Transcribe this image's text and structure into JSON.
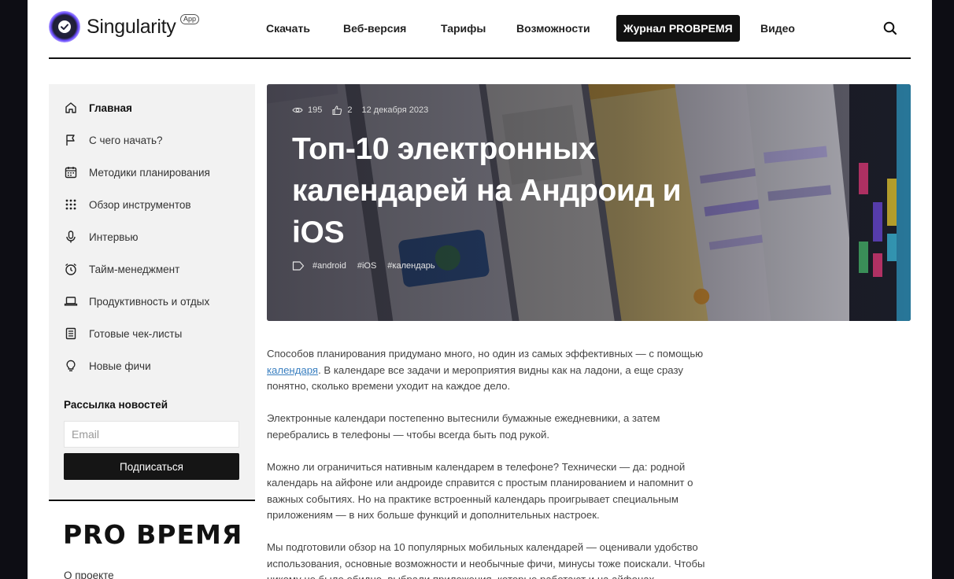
{
  "header": {
    "logo_text": "Singularity",
    "logo_badge": "App",
    "nav": [
      {
        "label": "Скачать"
      },
      {
        "label": "Веб-версия"
      },
      {
        "label": "Тарифы"
      },
      {
        "label": "Возможности"
      },
      {
        "label": "Журнал PROВРЕМЯ"
      },
      {
        "label": "Видео"
      }
    ],
    "search_icon": "search-icon"
  },
  "sidebar": {
    "items": [
      {
        "label": "Главная",
        "icon": "home-icon"
      },
      {
        "label": "С чего начать?",
        "icon": "flag-icon"
      },
      {
        "label": "Методики планирования",
        "icon": "calendar-icon"
      },
      {
        "label": "Обзор инструментов",
        "icon": "grid-dots-icon"
      },
      {
        "label": "Интервью",
        "icon": "microphone-icon"
      },
      {
        "label": "Тайм-менеджмент",
        "icon": "alarm-clock-icon"
      },
      {
        "label": "Продуктивность и отдых",
        "icon": "laptop-icon"
      },
      {
        "label": "Готовые чек-листы",
        "icon": "checklist-icon"
      },
      {
        "label": "Новые фичи",
        "icon": "lightbulb-icon"
      }
    ],
    "newsletter_title": "Рассылка новостей",
    "email_placeholder": "Email",
    "subscribe_label": "Подписаться",
    "brand": "PRO ВРЕМЯ",
    "about_link": "О проекте"
  },
  "hero": {
    "views": "195",
    "likes": "2",
    "date": "12 декабря 2023",
    "title": "Топ-10 электронных календарей на Андроид и iOS",
    "tags": [
      "#android",
      "#iOS",
      "#календарь"
    ]
  },
  "article": {
    "p1_before": "Способов планирования придумано много, но один из самых эффективных — с помощью ",
    "p1_link": "календаря",
    "p1_after": ". В календаре все задачи и мероприятия видны как на ладони, а еще сразу понятно, сколько времени уходит на каждое дело.",
    "p2": "Электронные календари постепенно вытеснили бумажные ежедневники, а затем перебрались в телефоны — чтобы всегда быть под рукой.",
    "p3": "Можно ли ограничиться нативным календарем в телефоне? Технически — да: родной календарь на айфоне или андроиде справится с простым планированием и напомнит о важных событиях. Но на практике встроенный календарь проигрывает специальным приложениям — в них больше функций и дополнительных настроек.",
    "p4": "Мы подготовили обзор на 10 популярных мобильных календарей — оценивали удобство использования, основные возможности и необычные фичи, минусы тоже поискали. Чтобы никому не было обидно, выбрали приложения, которые работают и на айфонах"
  }
}
